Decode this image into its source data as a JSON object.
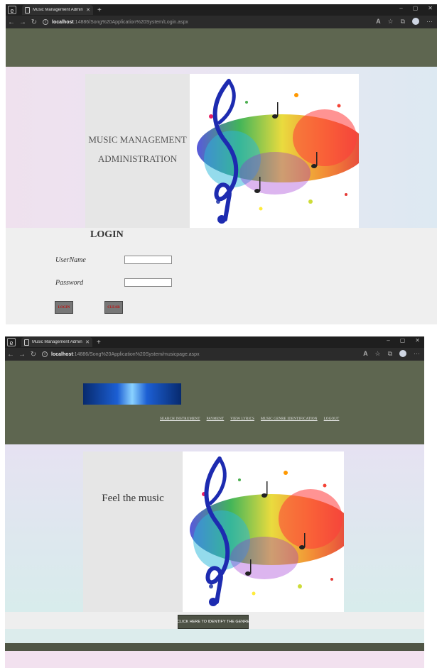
{
  "screen1": {
    "tab_title": "Music Management Administrat",
    "url_host": "localhost",
    "url_path": ":14886/Song%20Application%20System/Login.aspx",
    "brand_lines": [
      "MUSIC MANAGEMENT",
      "ADMINISTRATION"
    ],
    "login_heading": "LOGIN",
    "username_label": "UserName",
    "password_label": "Password",
    "username_value": "",
    "password_value": "",
    "login_button": "LOGIN",
    "clear_button": "CLEAR"
  },
  "screen2": {
    "tab_title": "Music Management Administrat",
    "url_host": "localhost",
    "url_path": ":14886/Song%20Application%20System/musicpage.aspx",
    "nav": [
      "SEARCH INSTRUMENT",
      "PAYMENT",
      "VIEW LYRICS",
      "MUSIC GENRE IDENTIFICATION",
      "LOGOUT"
    ],
    "tagline": "Feel the music",
    "identify_button": "CLICK HERE TO IDENTIFY THE GENRE"
  },
  "browser": {
    "new_tab": "+",
    "window_controls": [
      "–",
      "▢",
      "✕"
    ],
    "more": "···"
  },
  "colors": {
    "header": "#5e6650",
    "panel": "#e6e6e6",
    "button_text": "#b11111"
  },
  "icons": [
    "edge-app-icon",
    "page-icon",
    "close-icon",
    "back-icon",
    "forward-icon",
    "refresh-icon",
    "info-icon",
    "read-aloud-icon",
    "favorite-icon",
    "collections-icon",
    "profile-icon",
    "more-icon"
  ]
}
